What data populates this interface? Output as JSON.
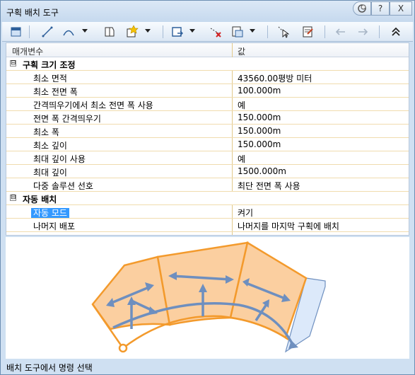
{
  "window": {
    "title": "구획 배치 도구",
    "restore_icon": "restore-icon",
    "help_label": "?",
    "close_label": "X"
  },
  "toolbar": {
    "icons": [
      "select-icon",
      "line-icon",
      "arc-icon",
      "boundary-icon",
      "add-parcel-icon",
      "insert-icon",
      "delete-vertex-icon",
      "slide-icon",
      "pick-point-icon",
      "properties-icon",
      "back-icon",
      "forward-icon",
      "collapse-icon"
    ]
  },
  "grid": {
    "header": {
      "param": "매개변수",
      "value": "값"
    },
    "groups": [
      {
        "label": "구획 크기 조정",
        "expander": "⊟",
        "rows": [
          {
            "name": "최소 면적",
            "value": "43560.00평방 미터"
          },
          {
            "name": "최소 전면 폭",
            "value": "100.000m"
          },
          {
            "name": "간격띄우기에서 최소 전면 폭 사용",
            "value": "예"
          },
          {
            "name": "전면 폭 간격띄우기",
            "value": "150.000m"
          },
          {
            "name": "최소 폭",
            "value": "150.000m"
          },
          {
            "name": "최소 깊이",
            "value": "150.000m"
          },
          {
            "name": "최대 깊이 사용",
            "value": "예"
          },
          {
            "name": "최대 깊이",
            "value": "1500.000m"
          },
          {
            "name": "다중 솔루션 선호",
            "value": "최단 전면 폭 사용"
          }
        ]
      },
      {
        "label": "자동 배치",
        "expander": "⊟",
        "rows": [
          {
            "name": "자동 모드",
            "value": "켜기"
          },
          {
            "name": "나머지 배포",
            "value": "나머지를 마지막 구획에 배치"
          }
        ]
      }
    ]
  },
  "colors": {
    "parcel_fill": "#fbcfa0",
    "parcel_stroke": "#f39a2c",
    "arrow": "#6e8fbf",
    "remainder_fill": "#dce9fa",
    "selection": "#3399ff"
  },
  "status": {
    "text": "배치 도구에서 명령 선택"
  }
}
